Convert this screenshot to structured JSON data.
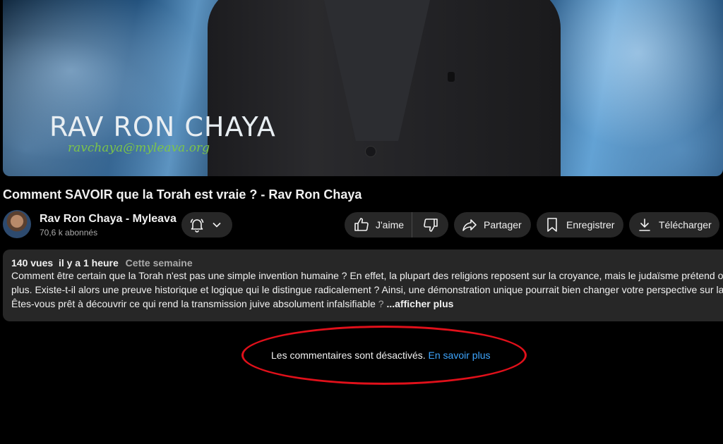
{
  "video": {
    "overlay_name": "RAV RON CHAYA",
    "overlay_email": "ravchaya@myleava.org"
  },
  "title": "Comment SAVOIR que la Torah est vraie ? - Rav Ron Chaya",
  "channel": {
    "name": "Rav Ron Chaya - Myleava",
    "subscribers": "70,6 k abonnés",
    "avatar_icon": "avatar"
  },
  "actions": {
    "like": "J'aime",
    "share": "Partager",
    "save": "Enregistrer",
    "download": "Télécharger"
  },
  "description": {
    "views": "140 vues",
    "time": "il y a 1 heure",
    "tag": "Cette semaine",
    "lines": [
      "Comment être certain que la Torah n'est pas une simple invention humaine ? En effet, la plupart des religions reposent sur la croyance, mais le judaïsme prétend offrir",
      "plus. Existe-t-il alors une preuve historique et logique qui le distingue radicalement ? Ainsi, une démonstration unique pourrait bien changer votre perspective sur la ve",
      "Êtes-vous prêt à découvrir ce qui rend la transmission juive absolument infalsifiable"
    ],
    "ellipsis": " ? ",
    "show_more": "...afficher plus"
  },
  "comments": {
    "disabled_text": "Les commentaires sont désactivés.",
    "learn_more": "En savoir plus"
  },
  "colors": {
    "background": "#000000",
    "pill": "#272727",
    "link": "#3ea6ff",
    "annotation": "#e0101a"
  }
}
